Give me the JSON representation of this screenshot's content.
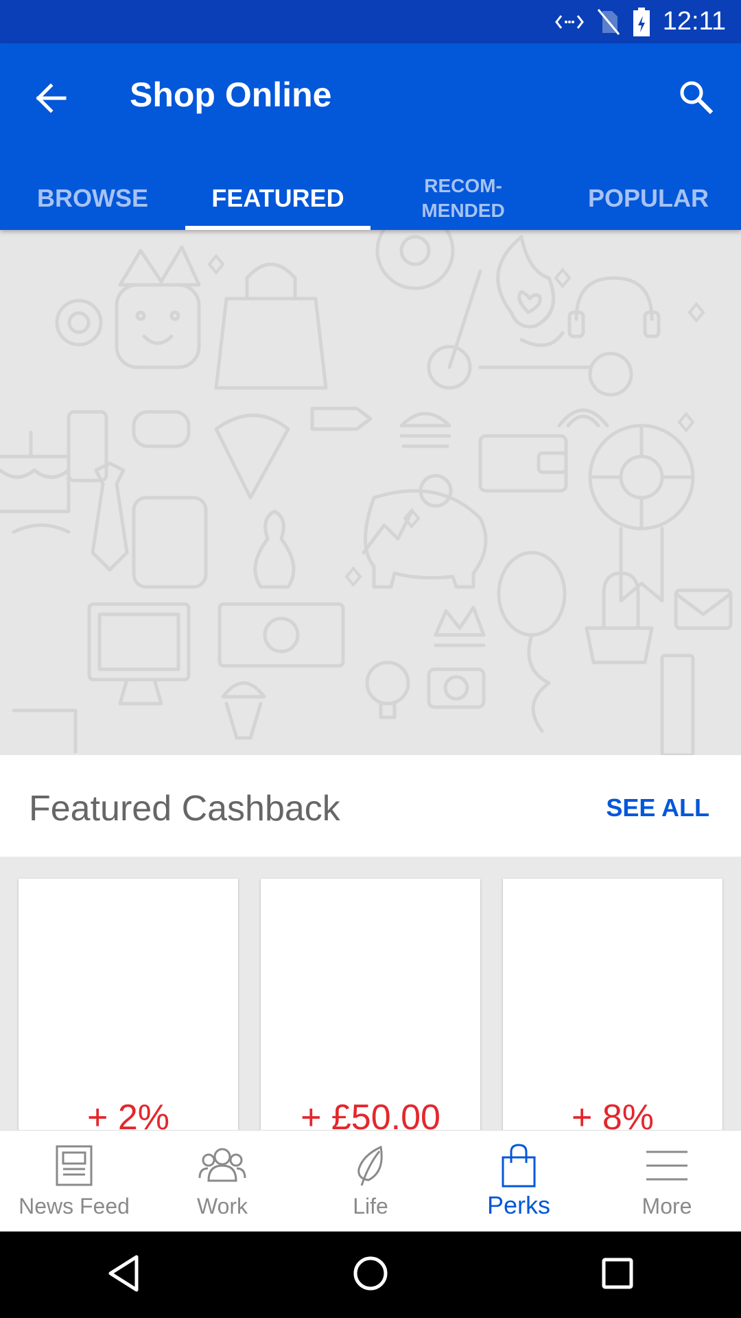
{
  "status_bar": {
    "time": "12:11",
    "icons": [
      "data-transfer-icon",
      "no-sim-icon",
      "battery-charging-icon"
    ]
  },
  "app_bar": {
    "title": "Shop Online",
    "back_icon": "arrow-left-icon",
    "search_icon": "search-icon",
    "tabs": [
      {
        "label": "BROWSE",
        "active": false
      },
      {
        "label_line1": "FEATURED",
        "active": true
      },
      {
        "label_line1": "RECOM-",
        "label_line2": "MENDED",
        "active": false
      },
      {
        "label": "POPULAR",
        "active": false
      }
    ]
  },
  "section": {
    "title": "Featured Cashback",
    "see_all": "SEE ALL"
  },
  "cards": [
    {
      "value": "+  2%"
    },
    {
      "value": "+  £50.00"
    },
    {
      "value": "+  8%"
    }
  ],
  "bottom_nav": [
    {
      "label": "News Feed",
      "icon": "newspaper-icon",
      "active": false
    },
    {
      "label": "Work",
      "icon": "people-icon",
      "active": false
    },
    {
      "label": "Life",
      "icon": "leaf-icon",
      "active": false
    },
    {
      "label": "Perks",
      "icon": "shopping-bag-icon",
      "active": true
    },
    {
      "label": "More",
      "icon": "menu-icon",
      "active": false
    }
  ],
  "colors": {
    "primary": "#0357d9",
    "status_bar": "#0a3fb7",
    "cashback": "#e3272d"
  }
}
